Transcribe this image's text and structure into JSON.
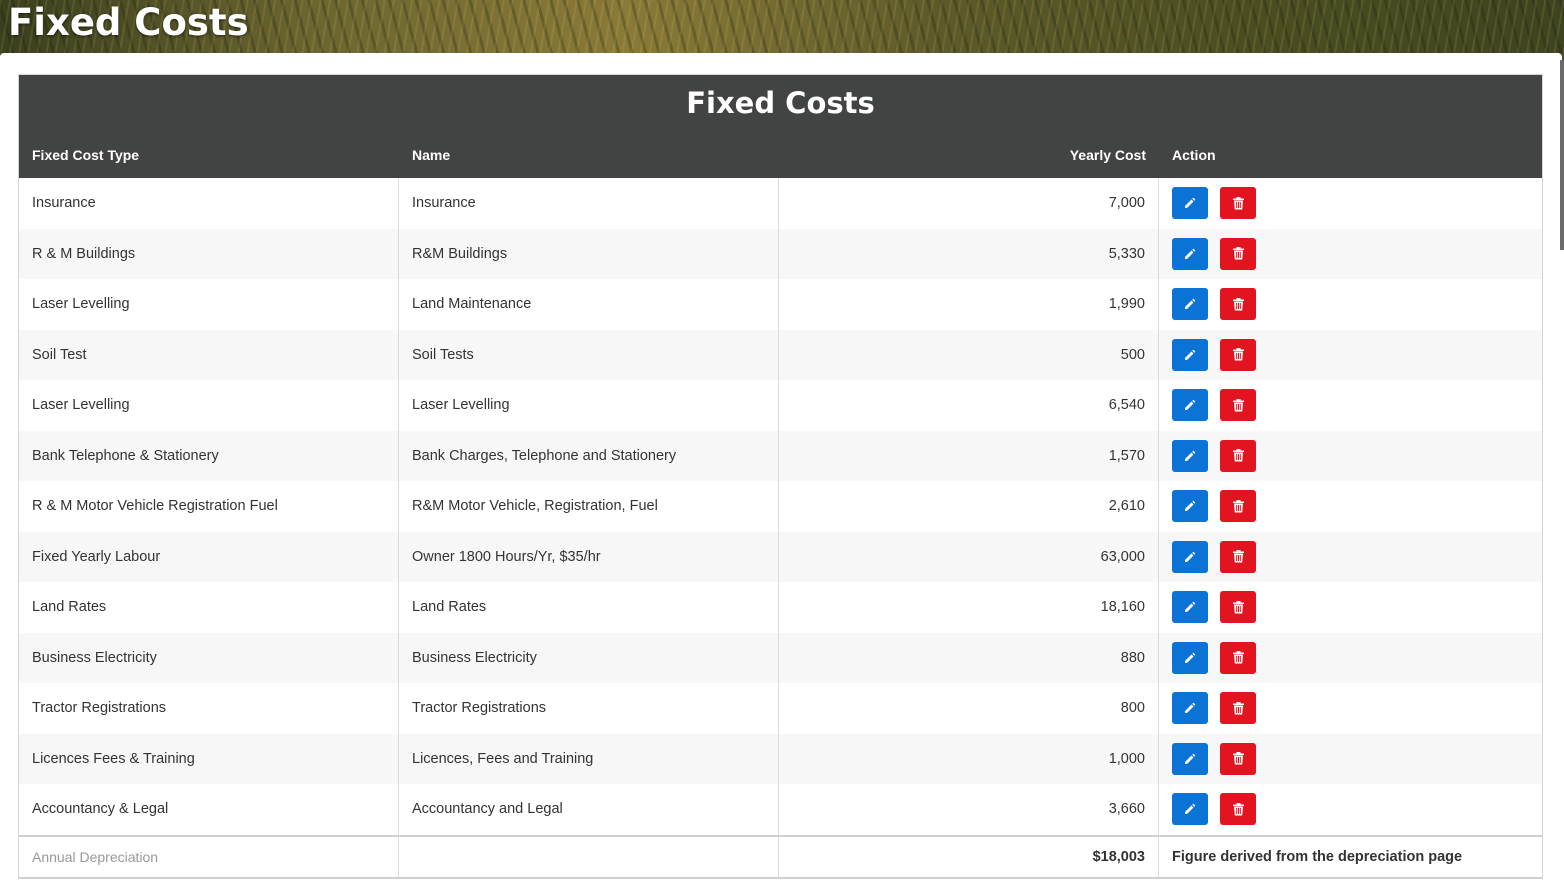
{
  "page": {
    "heading": "Fixed Costs"
  },
  "table": {
    "title": "Fixed Costs",
    "columns": [
      "Fixed Cost Type",
      "Name",
      "Yearly Cost",
      "Action"
    ],
    "rows": [
      {
        "type": "Insurance",
        "name": "Insurance",
        "cost": "7,000"
      },
      {
        "type": "R & M Buildings",
        "name": "R&M Buildings",
        "cost": "5,330"
      },
      {
        "type": "Laser Levelling",
        "name": "Land Maintenance",
        "cost": "1,990"
      },
      {
        "type": "Soil Test",
        "name": "Soil Tests",
        "cost": "500"
      },
      {
        "type": "Laser Levelling",
        "name": "Laser Levelling",
        "cost": "6,540"
      },
      {
        "type": "Bank Telephone & Stationery",
        "name": "Bank Charges, Telephone and Stationery",
        "cost": "1,570"
      },
      {
        "type": "R & M Motor Vehicle Registration Fuel",
        "name": "R&M Motor Vehicle, Registration, Fuel",
        "cost": "2,610"
      },
      {
        "type": "Fixed Yearly Labour",
        "name": "Owner 1800 Hours/Yr, $35/hr",
        "cost": "63,000"
      },
      {
        "type": "Land Rates",
        "name": "Land Rates",
        "cost": "18,160"
      },
      {
        "type": "Business Electricity",
        "name": "Business Electricity",
        "cost": "880"
      },
      {
        "type": "Tractor Registrations",
        "name": "Tractor Registrations",
        "cost": "800"
      },
      {
        "type": "Licences Fees & Training",
        "name": "Licences, Fees and Training",
        "cost": "1,000"
      },
      {
        "type": "Accountancy & Legal",
        "name": "Accountancy and Legal",
        "cost": "3,660"
      }
    ],
    "footer": {
      "label": "Annual Depreciation",
      "total": "$18,003",
      "note": "Figure derived from the depreciation page"
    }
  },
  "colors": {
    "header_bg": "#424443",
    "edit": "#0b72d6",
    "delete": "#e2141f"
  },
  "icons": {
    "edit": "pencil-icon",
    "delete": "trash-icon"
  }
}
